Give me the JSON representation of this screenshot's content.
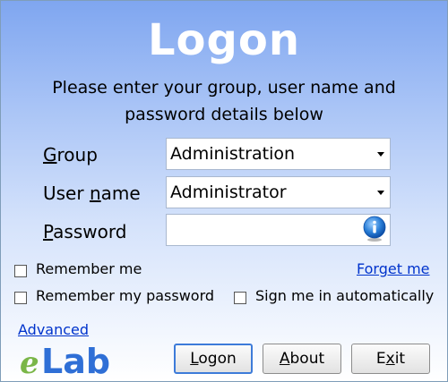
{
  "dialog": {
    "title": "Logon",
    "instructions_line1": "Please enter your group, user name and",
    "instructions_line2": "password details below"
  },
  "form": {
    "group": {
      "label_prefix": "G",
      "label_rest": "roup",
      "value": "Administration"
    },
    "username": {
      "label_prefix": "User ",
      "label_underlined": "n",
      "label_rest": "ame",
      "value": "Administrator"
    },
    "password": {
      "label_prefix": "P",
      "label_rest": "assword",
      "value": ""
    }
  },
  "options": {
    "remember_me": {
      "label": "Remember me",
      "checked": false
    },
    "remember_password": {
      "label": "Remember my password",
      "checked": false
    },
    "sign_in_auto": {
      "label": "Sign me in automatically",
      "checked": false
    },
    "forget_me": "Forget me",
    "advanced": "Advanced"
  },
  "logo": {
    "text": "Lab",
    "accent": "e"
  },
  "buttons": {
    "logon": {
      "prefix": "",
      "underlined": "L",
      "rest": "ogon"
    },
    "about": {
      "prefix": "",
      "underlined": "A",
      "rest": "bout"
    },
    "exit": {
      "prefix": "E",
      "underlined": "x",
      "rest": "it"
    }
  },
  "colors": {
    "gradient_top": "#7fa6f0",
    "link": "#0033cc",
    "logo_blue": "#2f6fd6",
    "logo_green": "#7ab648"
  },
  "icons": {
    "password_hint": "info-icon",
    "dropdown": "chevron-down-icon"
  }
}
